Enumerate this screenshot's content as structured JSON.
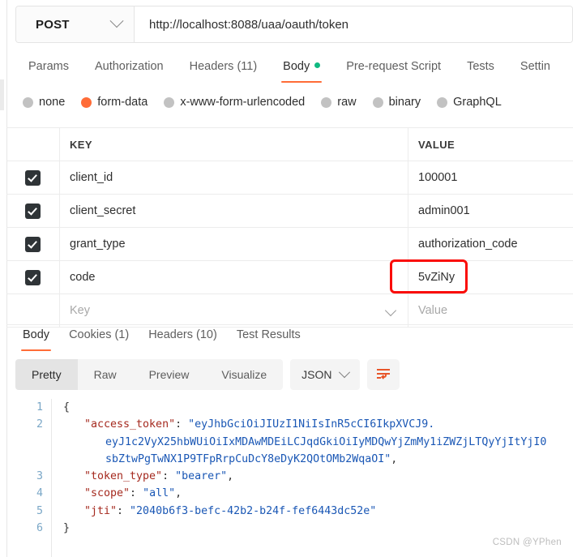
{
  "request": {
    "method": "POST",
    "url": "http://localhost:8088/uaa/oauth/token",
    "tabs": [
      {
        "label": "Params"
      },
      {
        "label": "Authorization"
      },
      {
        "label": "Headers (11)"
      },
      {
        "label": "Body"
      },
      {
        "label": "Pre-request Script"
      },
      {
        "label": "Tests"
      },
      {
        "label": "Settin"
      }
    ],
    "body_types": [
      {
        "label": "none",
        "selected": false
      },
      {
        "label": "form-data",
        "selected": true
      },
      {
        "label": "x-www-form-urlencoded",
        "selected": false
      },
      {
        "label": "raw",
        "selected": false
      },
      {
        "label": "binary",
        "selected": false
      },
      {
        "label": "GraphQL",
        "selected": false
      }
    ],
    "table": {
      "columns": [
        "KEY",
        "VALUE"
      ],
      "rows": [
        {
          "key": "client_id",
          "value": "100001",
          "checked": true
        },
        {
          "key": "client_secret",
          "value": "admin001",
          "checked": true
        },
        {
          "key": "grant_type",
          "value": "authorization_code",
          "checked": true
        },
        {
          "key": "code",
          "value": "5vZiNy",
          "checked": true
        }
      ],
      "new_row": {
        "key_placeholder": "Key",
        "value_placeholder": "Value"
      }
    }
  },
  "response": {
    "tabs": [
      {
        "label": "Body"
      },
      {
        "label": "Cookies (1)"
      },
      {
        "label": "Headers (10)"
      },
      {
        "label": "Test Results"
      }
    ],
    "view_modes": [
      {
        "label": "Pretty",
        "active": true
      },
      {
        "label": "Raw",
        "active": false
      },
      {
        "label": "Preview",
        "active": false
      },
      {
        "label": "Visualize",
        "active": false
      }
    ],
    "language": "JSON",
    "body_lines": [
      {
        "num": "1",
        "indent": 0,
        "segments": [
          {
            "t": "{",
            "c": "p"
          }
        ]
      },
      {
        "num": "2",
        "indent": 1,
        "segments": [
          {
            "t": "\"access_token\"",
            "c": "k"
          },
          {
            "t": ": ",
            "c": "p"
          },
          {
            "t": "\"eyJhbGciOiJIUzI1NiIsInR5cCI6IkpXVCJ9.",
            "c": "v"
          }
        ]
      },
      {
        "num": "",
        "indent": 2,
        "segments": [
          {
            "t": "eyJ1c2VyX25hbWUiOiIxMDAwMDEiLCJqdGkiOiIyMDQwYjZmMy1iZWZjLTQyYjItYjI0",
            "c": "v"
          }
        ]
      },
      {
        "num": "",
        "indent": 2,
        "segments": [
          {
            "t": "sbZtwPgTwNX1P9TFpRrpCuDcY8eDyK2QOtOMb2WqaOI\"",
            "c": "v"
          },
          {
            "t": ",",
            "c": "p"
          }
        ]
      },
      {
        "num": "3",
        "indent": 1,
        "segments": [
          {
            "t": "\"token_type\"",
            "c": "k"
          },
          {
            "t": ": ",
            "c": "p"
          },
          {
            "t": "\"bearer\"",
            "c": "v"
          },
          {
            "t": ",",
            "c": "p"
          }
        ]
      },
      {
        "num": "4",
        "indent": 1,
        "segments": [
          {
            "t": "\"scope\"",
            "c": "k"
          },
          {
            "t": ": ",
            "c": "p"
          },
          {
            "t": "\"all\"",
            "c": "v"
          },
          {
            "t": ",",
            "c": "p"
          }
        ]
      },
      {
        "num": "5",
        "indent": 1,
        "segments": [
          {
            "t": "\"jti\"",
            "c": "k"
          },
          {
            "t": ": ",
            "c": "p"
          },
          {
            "t": "\"2040b6f3-befc-42b2-b24f-fef6443dc52e\"",
            "c": "v"
          }
        ]
      },
      {
        "num": "6",
        "indent": 0,
        "segments": [
          {
            "t": "}",
            "c": "p"
          }
        ]
      }
    ]
  },
  "watermark": "CSDN @YPhen",
  "colors": {
    "accent": "#ff6c37",
    "green": "#10b981",
    "highlight": "#fa0c08",
    "checkbox": "#2f3437"
  }
}
